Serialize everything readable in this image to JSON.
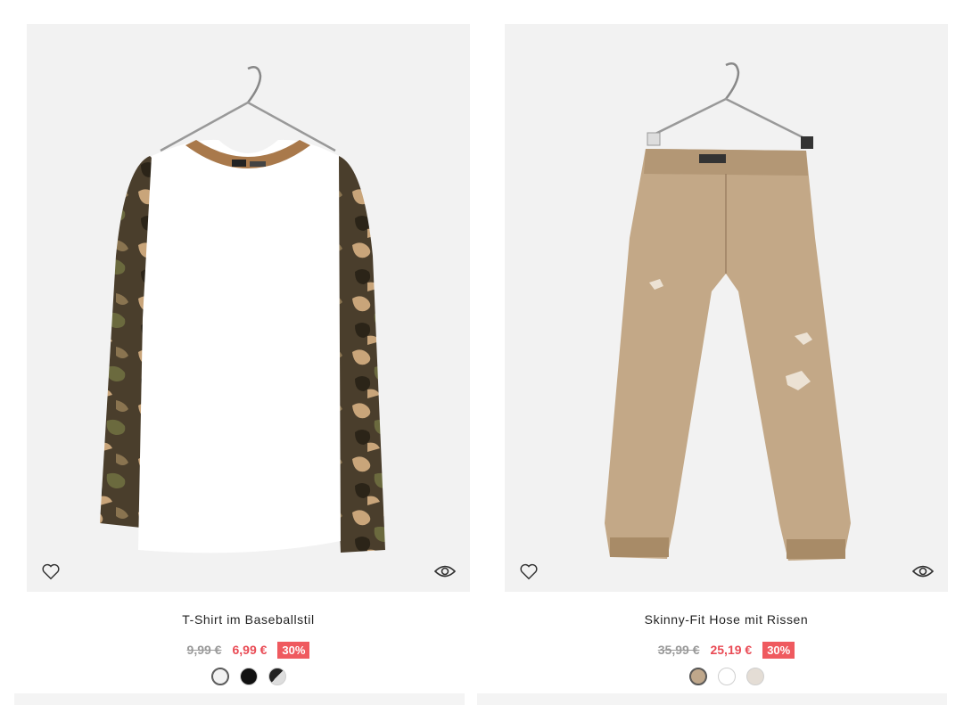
{
  "products": [
    {
      "name": "T-Shirt im Baseballstil",
      "old_price": "9,99 €",
      "new_price": "6,99 €",
      "discount": "30%",
      "image_icon": "raglan-tshirt-camo",
      "wishlist_icon": "heart-icon",
      "quickview_icon": "eye-icon",
      "swatches": [
        {
          "color": "#f2f2f2",
          "label": "white"
        },
        {
          "color": "#111111",
          "label": "black"
        },
        {
          "color": "#777777",
          "label": "grey-white"
        }
      ]
    },
    {
      "name": "Skinny-Fit Hose mit Rissen",
      "old_price": "35,99 €",
      "new_price": "25,19 €",
      "discount": "30%",
      "image_icon": "beige-skinny-jeans",
      "wishlist_icon": "heart-icon",
      "quickview_icon": "eye-icon",
      "swatches": [
        {
          "color": "#bfa78b",
          "label": "beige"
        },
        {
          "color": "#ffffff",
          "label": "white"
        },
        {
          "color": "#e4ddd5",
          "label": "light-grey"
        }
      ]
    }
  ],
  "colors": {
    "sale_red": "#e94b55",
    "badge_red": "#ef5a5f",
    "old_price_grey": "#9a9a9a",
    "photo_bg": "#f2f2f2"
  }
}
